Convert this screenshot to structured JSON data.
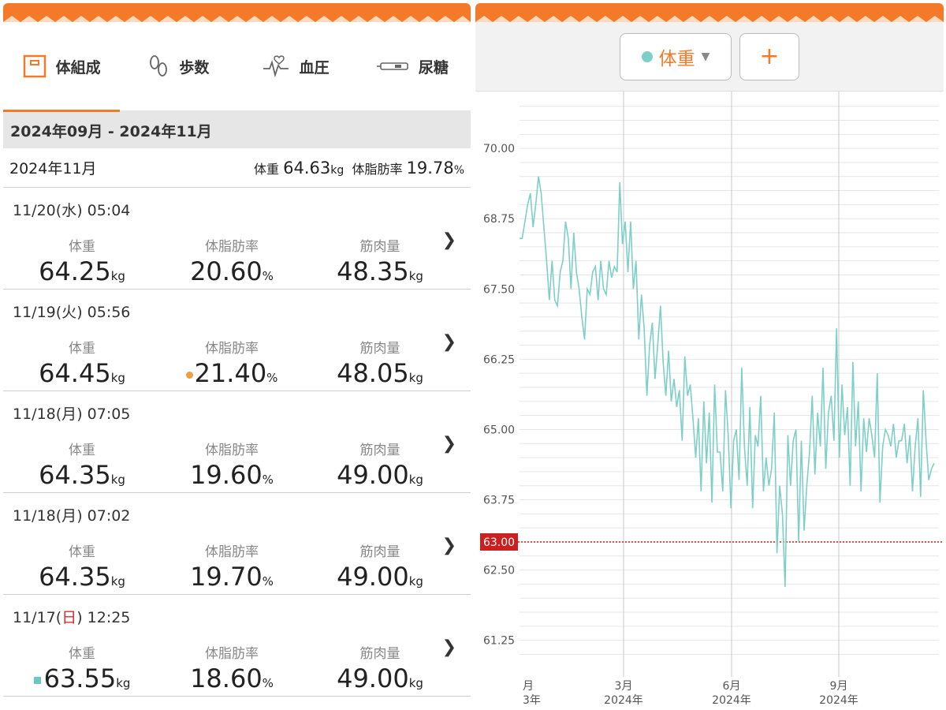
{
  "tabs": [
    {
      "label": "体組成",
      "icon": "body-composition-icon",
      "active": true
    },
    {
      "label": "歩数",
      "icon": "footsteps-icon",
      "active": false
    },
    {
      "label": "血圧",
      "icon": "heart-pulse-icon",
      "active": false
    },
    {
      "label": "尿糖",
      "icon": "urine-test-icon",
      "active": false
    }
  ],
  "range_label": "2024年09月 - 2024年11月",
  "month_summary": {
    "month": "2024年11月",
    "weight_label": "体重",
    "weight_value": "64.63",
    "weight_unit": "kg",
    "fat_label": "体脂肪率",
    "fat_value": "19.78",
    "fat_unit": "%"
  },
  "labels": {
    "weight": "体重",
    "fat": "体脂肪率",
    "muscle": "筋肉量",
    "kg": "kg",
    "pct": "%"
  },
  "entries": [
    {
      "date_pre": "11/20(",
      "day": "水",
      "date_post": ") 05:04",
      "weight": "64.25",
      "fat": "20.60",
      "muscle": "48.35"
    },
    {
      "date_pre": "11/19(",
      "day": "火",
      "date_post": ") 05:56",
      "weight": "64.45",
      "fat": "21.40",
      "muscle": "48.05"
    },
    {
      "date_pre": "11/18(",
      "day": "月",
      "date_post": ") 07:05",
      "weight": "64.35",
      "fat": "19.60",
      "muscle": "49.00"
    },
    {
      "date_pre": "11/18(",
      "day": "月",
      "date_post": ") 07:02",
      "weight": "64.35",
      "fat": "19.70",
      "muscle": "49.00"
    },
    {
      "date_pre": "11/17(",
      "day": "日",
      "date_post": ") 12:25",
      "weight": "63.55",
      "fat": "18.60",
      "muscle": "49.00"
    }
  ],
  "right": {
    "selector_label": "体重",
    "add_label": "+"
  },
  "colors": {
    "accent": "#f47a2a",
    "line": "#7ecfc8",
    "target": "#cc1f1f"
  },
  "chart_data": {
    "type": "line",
    "ylabel_ticks": [
      "70.00",
      "68.75",
      "67.50",
      "66.25",
      "65.00",
      "63.75",
      "62.50",
      "61.25"
    ],
    "ylim": [
      60.6,
      70.9
    ],
    "target_line": 63.0,
    "target_label": "63.00",
    "x_ticks": [
      {
        "line1": "月",
        "line2": "3年"
      },
      {
        "line1": "3月",
        "line2": "2024年"
      },
      {
        "line1": "6月",
        "line2": "2024年"
      },
      {
        "line1": "9月",
        "line2": "2024年"
      }
    ],
    "series": [
      {
        "values": [
          68.4,
          68.4,
          68.7,
          69.0,
          69.2,
          68.6,
          69.0,
          69.5,
          69.2,
          68.6,
          68.0,
          67.3,
          68.0,
          67.3,
          67.2,
          67.8,
          68.0,
          68.7,
          68.4,
          67.5,
          68.5,
          67.8,
          67.5,
          67.0,
          66.6,
          67.5,
          67.4,
          67.8,
          67.9,
          67.3,
          68.0,
          67.5,
          67.4,
          68.0,
          67.7,
          67.9,
          67.8,
          69.4,
          68.3,
          68.7,
          67.8,
          68.7,
          67.5,
          68.0,
          66.6,
          67.4,
          66.8,
          65.6,
          66.5,
          66.9,
          65.9,
          66.5,
          67.2,
          66.2,
          65.6,
          66.4,
          65.5,
          65.9,
          65.4,
          65.7,
          64.8,
          66.3,
          65.6,
          65.8,
          65.2,
          64.5,
          65.2,
          63.9,
          65.5,
          64.4,
          65.3,
          63.7,
          65.8,
          64.6,
          64.6,
          63.9,
          65.7,
          64.9,
          63.6,
          64.8,
          65.0,
          64.1,
          66.1,
          64.7,
          64.0,
          65.4,
          63.6,
          64.9,
          64.7,
          65.6,
          63.9,
          64.5,
          64.0,
          64.3,
          65.3,
          62.8,
          64.0,
          63.5,
          62.2,
          64.9,
          64.0,
          64.8,
          65.0,
          63.0,
          64.8,
          63.2,
          64.0,
          64.6,
          65.6,
          64.2,
          65.3,
          64.7,
          66.1,
          64.3,
          65.3,
          65.6,
          64.8,
          66.8,
          64.5,
          65.8,
          64.9,
          65.4,
          64.0,
          66.2,
          64.7,
          65.5,
          63.9,
          65.2,
          64.6,
          65.2,
          64.9,
          64.5,
          66.0,
          63.7,
          64.7,
          65.0,
          64.9,
          64.7,
          65.1,
          64.5,
          64.8,
          64.8,
          65.1,
          64.4,
          64.9,
          63.9,
          64.7,
          65.2,
          63.8,
          65.7,
          64.8,
          64.1,
          64.3,
          64.4
        ]
      }
    ]
  }
}
